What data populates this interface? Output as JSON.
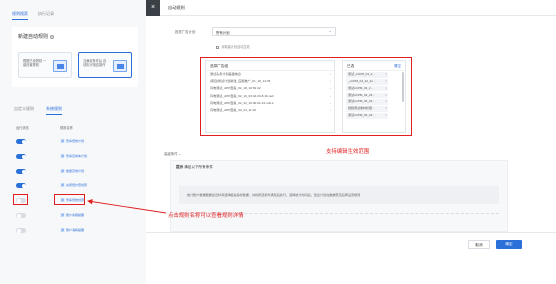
{
  "left": {
    "tabs": [
      "规则搜索",
      "执行记录"
    ],
    "card_title": "新建自动规则",
    "options": [
      {
        "text": "根据已设规则 一键设置规则"
      },
      {
        "text": "当满足条件后 自动执行相应操作"
      }
    ],
    "subtabs": [
      "自定义规则",
      "系统规则"
    ],
    "col_status": "运行状态",
    "col_name": "规则名称",
    "rules": [
      {
        "tag": "通",
        "name": "暂停低效计划"
      },
      {
        "tag": "通",
        "name": "暂停高成本计划"
      },
      {
        "tag": "通",
        "name": "放量高效计划"
      },
      {
        "tag": "通",
        "name": "关闭低价值创意"
      },
      {
        "tag": "通",
        "name": "暂停低效创意"
      },
      {
        "tag": "通",
        "name": "账户余额提醒"
      },
      {
        "tag": "通",
        "name": "账户消耗提醒"
      }
    ]
  },
  "dialog": {
    "close_icon": "×",
    "title": "自动规则",
    "scope_label": "投放广告计划",
    "scope_value": "所有计划",
    "check_text": "对新建计划自动生效",
    "transfer": {
      "left_head": "选择广告组",
      "left_items": [
        "测试头条计划基础信息",
        "[项目]测试计划新建_应用推广_01_18_14:45",
        "闪电测试_APP直投_02_18_16:52:42",
        "闪电测试_APP直投_02_19_03:44:23-8-19-null",
        "闪电测试_APP直投_02_22_10:30:01-13-null-2",
        "闪电测试_APP直投_02_23_11:16"
      ],
      "right_head": "已选",
      "right_clear": "清空",
      "right_items": [
        "测试_oCPM_04_2…",
        "_oCPM_04_22_11…",
        "测试oCPM_04_2…",
        "测试oCPM_04_22…",
        "测试oCPM_04_22…",
        "视频测试素材标题…",
        "测试oCPM_04_22…"
      ]
    },
    "advanced_label": "高级条件",
    "hint_title_bold": "提示",
    "hint_title_rest": "满足以下所有条件",
    "hint_body": "统计账户数据根据最近时间选择相关指标数据，并将所选条件满足后执行。选择统计时间后，建议计划在数据稳定后再设置规则",
    "cancel": "取消",
    "ok": "确定"
  },
  "annotations": {
    "scope": "支持编辑生效范围",
    "rule_detail": "点击规则名称可以查看规则详情"
  },
  "colors": {
    "accent": "#2b6fd8",
    "annotation": "#e02020"
  }
}
